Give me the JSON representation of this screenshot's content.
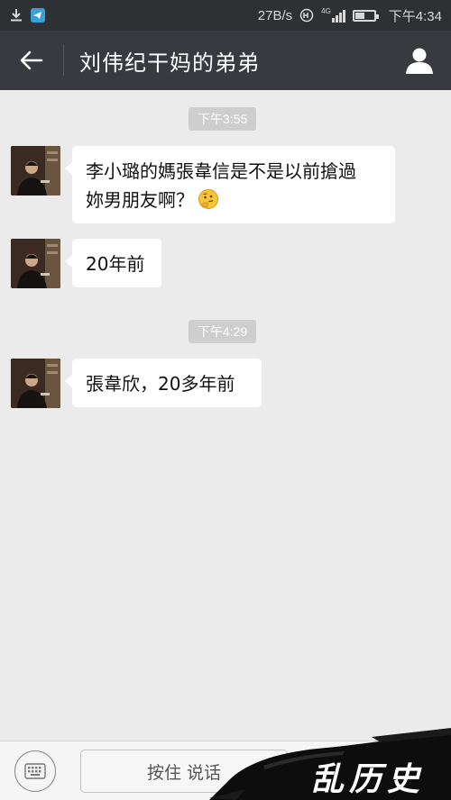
{
  "status_bar": {
    "net_speed": "27B/s",
    "time": "下午4:34",
    "signal_label": "4G"
  },
  "header": {
    "title": "刘伟纪干妈的弟弟"
  },
  "messages": [
    {
      "type": "time",
      "text": "下午3:55"
    },
    {
      "type": "incoming",
      "line1": "李小璐的媽張韋信是不是以前搶過",
      "line2": "妳男朋友啊？",
      "emoji": "thinking-face"
    },
    {
      "type": "incoming",
      "text": "20年前"
    },
    {
      "type": "time",
      "text": "下午4:29"
    },
    {
      "type": "incoming",
      "text": "張韋欣，20多年前"
    }
  ],
  "input_bar": {
    "hold_to_talk_label": "按住 说话"
  },
  "watermark": {
    "text": "乱历史"
  },
  "colors": {
    "status_bg": "#2e3134",
    "header_bg": "#393a3f",
    "chat_bg": "#ebebeb",
    "bubble_bg": "#ffffff",
    "time_pill_bg": "#cecece"
  }
}
